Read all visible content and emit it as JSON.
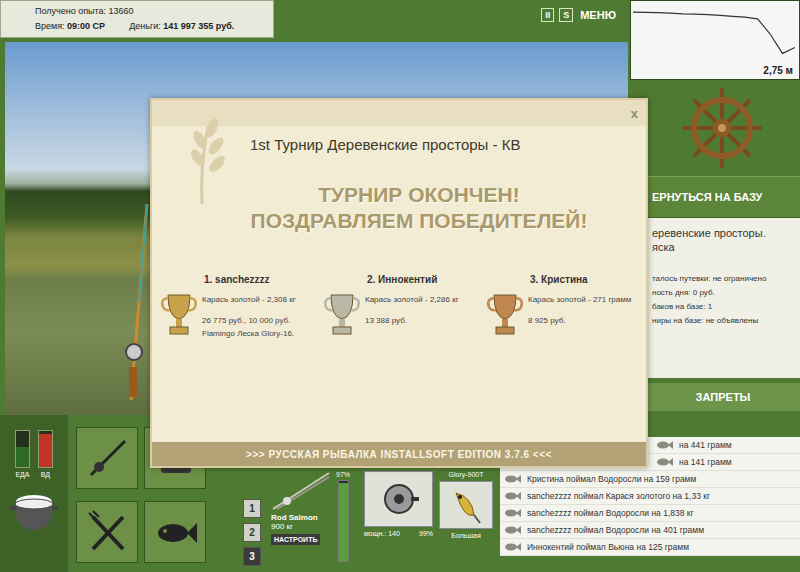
{
  "status": {
    "experience": "Получено опыта: 13660",
    "time_label": "Время:",
    "time": "09:00 СР",
    "money_label": "Деньги:",
    "money": "141 997 355 руб."
  },
  "top_buttons": [
    {
      "label": "II"
    },
    {
      "label": "S"
    },
    {
      "label": "МЕНЮ"
    }
  ],
  "depth_chart": {
    "values": [
      0.3,
      0.32,
      0.34,
      0.36,
      0.4,
      0.42,
      0.45,
      0.5,
      0.55,
      0.6,
      0.7,
      1.6,
      2.75,
      2.4
    ],
    "reading": "2,75 м"
  },
  "side_panel": {
    "return_button": "ЕРНУТЬСЯ НА БАЗУ",
    "location": "еревенские просторы.",
    "sublocation": "яска",
    "info": [
      "талось путевки: не ограничено",
      "ность дня: 0 руб.",
      "баков на базе: 1",
      "ниры на базе: не объявлены"
    ],
    "bans_button": "ЗАПРЕТЫ"
  },
  "meters": [
    {
      "label": "ЕДА",
      "level": 0.55,
      "color": "#2f6a26"
    },
    {
      "label": "ВД",
      "level": 0.92,
      "color": "#c23323"
    }
  ],
  "slots": [
    {
      "label": "1",
      "selected": false
    },
    {
      "label": "2",
      "selected": false
    },
    {
      "label": "3",
      "selected": true
    }
  ],
  "rod": {
    "name": "Rod Salmon",
    "strength": "900 кг",
    "button": "НАСТРОИТЬ",
    "durability": "97%",
    "level": 0.97
  },
  "reel": {
    "power": "мощн.: 140",
    "durability": "99%"
  },
  "tackle": {
    "line": "Glory-900T",
    "lure": "Большая"
  },
  "log": [
    "на 441 грамм",
    "на 141 грамм",
    "Кристина поймал Водоросли на 159 грамм",
    "sanchezzzz поймал Карася золотого на 1,33 кг",
    "sanchezzzz поймал Водоросли на 1,838 кг",
    "sanchezzzz поймал Водоросли на 401 грамм",
    "Иннокентий поймал Вьюна на 125 грамм"
  ],
  "dialog": {
    "title": "1st Турнир Деревенские просторы - КВ",
    "close": "x",
    "headline": "ТУРНИР ОКОНЧЕН!",
    "subheadline": "ПОЗДРАВЛЯЕМ ПОБЕДИТЕЛЕЙ!",
    "winners": [
      {
        "place": "1. sanchezzzz",
        "fish": "Карась золотой - 2,308 кг",
        "prizes": [
          "26 775 руб., 10 000 руб.",
          "Flamingo Леска Glory-16."
        ],
        "color": "#c9a24c"
      },
      {
        "place": "2. Иннокентий",
        "fish": "Карась золотой - 2,286 кг",
        "prizes": [
          "13 388 руб."
        ],
        "color": "#b9b7a6"
      },
      {
        "place": "3. Кристина",
        "fish": "Карась золотой - 271 грамм",
        "prizes": [
          "8 925 руб."
        ],
        "color": "#c0874e"
      }
    ],
    "footer": ">>> РУССКАЯ РЫБАЛКА INSTALLSOFT EDITION 3.7.6 <<<"
  }
}
